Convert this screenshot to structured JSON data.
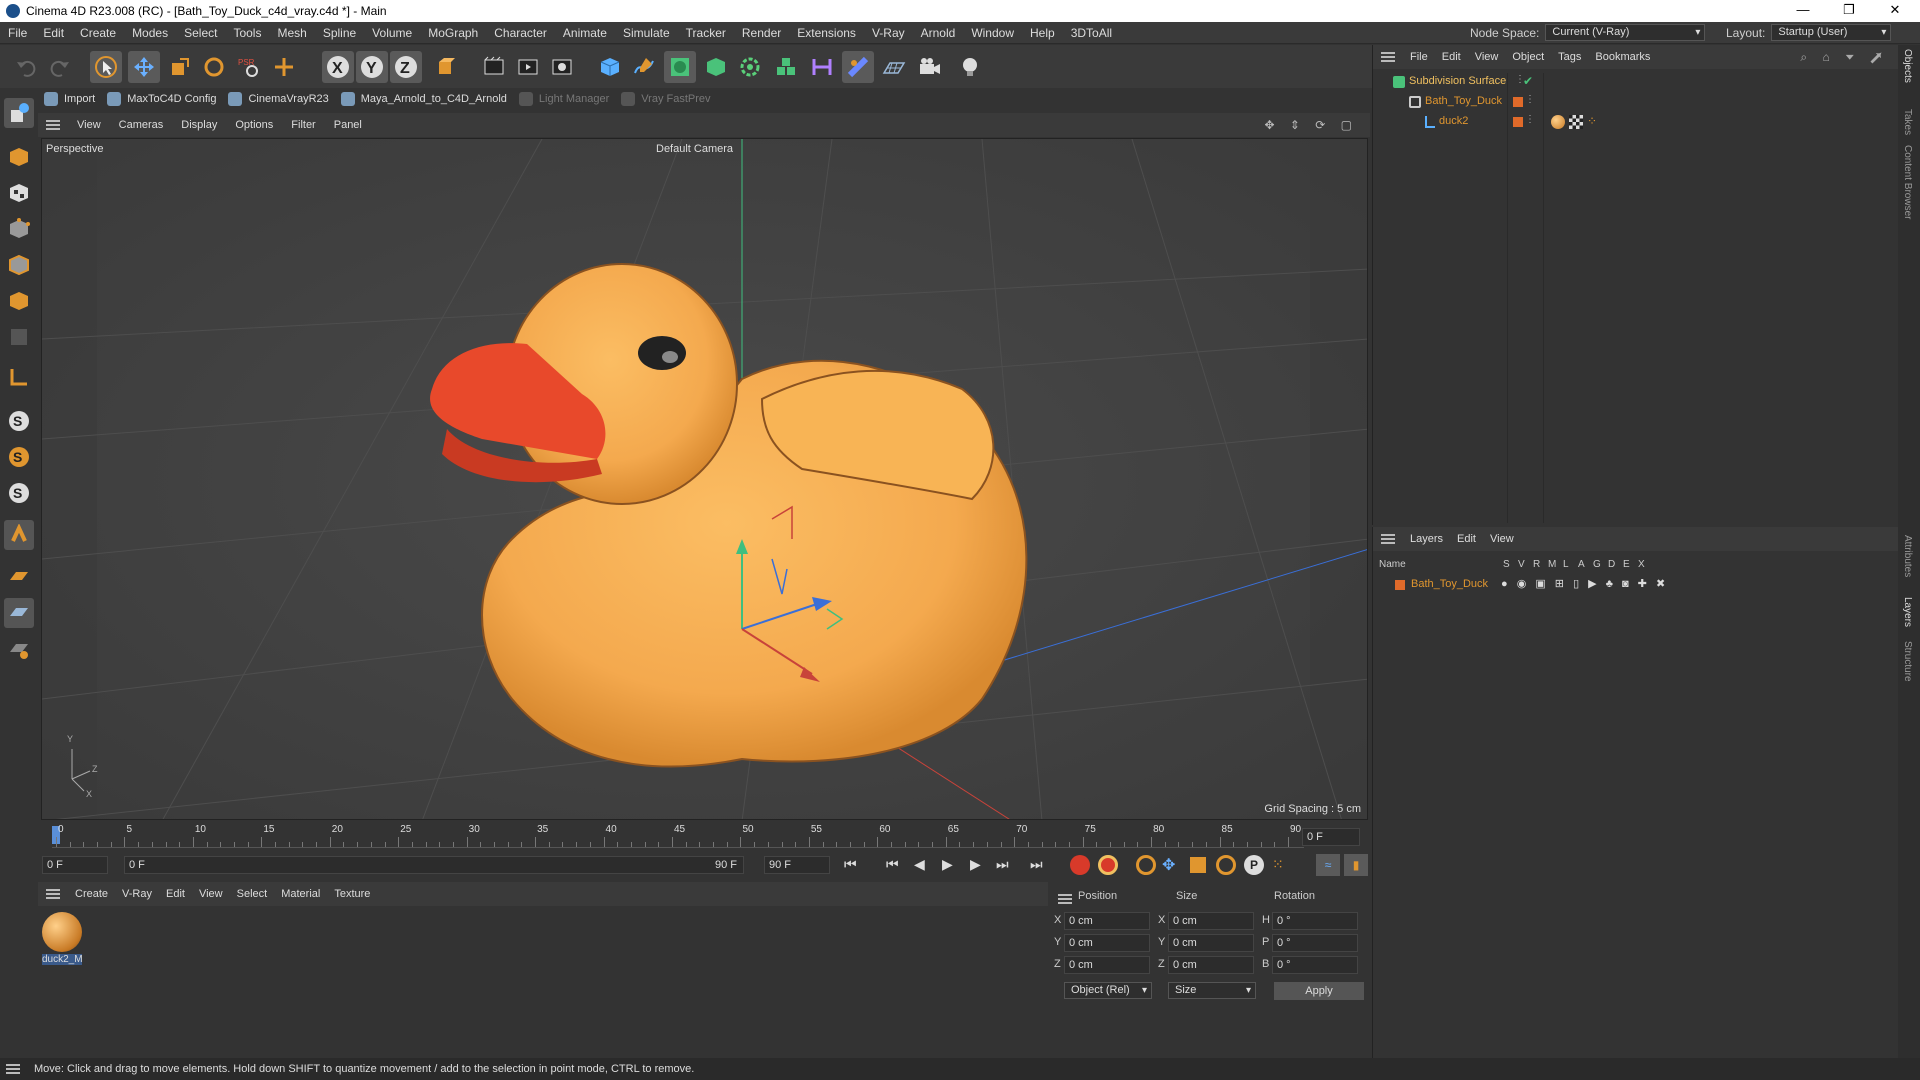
{
  "window": {
    "title": "Cinema 4D R23.008 (RC) - [Bath_Toy_Duck_c4d_vray.c4d *] - Main"
  },
  "menus": [
    "File",
    "Edit",
    "Create",
    "Modes",
    "Select",
    "Tools",
    "Mesh",
    "Spline",
    "Volume",
    "MoGraph",
    "Character",
    "Animate",
    "Simulate",
    "Tracker",
    "Render",
    "Extensions",
    "V-Ray",
    "Arnold",
    "Window",
    "Help",
    "3DToAll"
  ],
  "node_space": {
    "label": "Node Space:",
    "value": "Current (V-Ray)"
  },
  "layout": {
    "label": "Layout:",
    "value": "Startup (User)"
  },
  "subtoolbar": {
    "import": "Import",
    "maxto": "MaxToC4D Config",
    "cinemavray": "CinemaVrayR23",
    "maya": "Maya_Arnold_to_C4D_Arnold",
    "light": "Light Manager",
    "vrayfast": "Vray FastPrev"
  },
  "viewport": {
    "menu": [
      "View",
      "Cameras",
      "Display",
      "Options",
      "Filter",
      "Panel"
    ],
    "label": "Perspective",
    "camera": "Default Camera",
    "grid_spacing": "Grid Spacing : 5 cm"
  },
  "timeline": {
    "ticks": [
      "0",
      "5",
      "10",
      "15",
      "20",
      "25",
      "30",
      "35",
      "40",
      "45",
      "50",
      "55",
      "60",
      "65",
      "70",
      "75",
      "80",
      "85",
      "90"
    ],
    "current_frame": "0 F",
    "end_label": "0 F",
    "start_field": "0 F",
    "range_start": "0 F",
    "range_end": "90 F",
    "end_field": "90 F"
  },
  "materials": {
    "menu": [
      "Create",
      "V-Ray",
      "Edit",
      "View",
      "Select",
      "Material",
      "Texture"
    ],
    "items": [
      {
        "label": "duck2_M"
      }
    ]
  },
  "attributes": {
    "headers": {
      "position": "Position",
      "size": "Size",
      "rotation": "Rotation"
    },
    "rows": [
      {
        "axis": "X",
        "pos": "0 cm",
        "saxis": "X",
        "size": "0 cm",
        "raxis": "H",
        "rot": "0 °"
      },
      {
        "axis": "Y",
        "pos": "0 cm",
        "saxis": "Y",
        "size": "0 cm",
        "raxis": "P",
        "rot": "0 °"
      },
      {
        "axis": "Z",
        "pos": "0 cm",
        "saxis": "Z",
        "size": "0 cm",
        "raxis": "B",
        "rot": "0 °"
      }
    ],
    "mode": "Object (Rel)",
    "size_mode": "Size",
    "apply": "Apply"
  },
  "objects": {
    "menu": [
      "File",
      "Edit",
      "View",
      "Object",
      "Tags",
      "Bookmarks"
    ],
    "tree": [
      {
        "name": "Subdivision Surface",
        "indent": 0
      },
      {
        "name": "Bath_Toy_Duck",
        "indent": 1
      },
      {
        "name": "duck2",
        "indent": 2
      }
    ]
  },
  "layers": {
    "menu": [
      "Layers",
      "Edit",
      "View"
    ],
    "columns": {
      "name": "Name",
      "flags": [
        "S",
        "V",
        "R",
        "M",
        "L",
        "A",
        "G",
        "D",
        "E",
        "X"
      ]
    },
    "rows": [
      {
        "name": "Bath_Toy_Duck"
      }
    ]
  },
  "side_tabs": [
    "Objects",
    "Takes",
    "Content Browser",
    "Attributes",
    "Layers",
    "Structure"
  ],
  "status": "Move: Click and drag to move elements. Hold down SHIFT to quantize movement / add to the selection in point mode, CTRL to remove.",
  "colors": {
    "accent": "#e0962f",
    "duck_body": "#f4a94e",
    "beak": "#e8492b",
    "bg": "#333333"
  }
}
